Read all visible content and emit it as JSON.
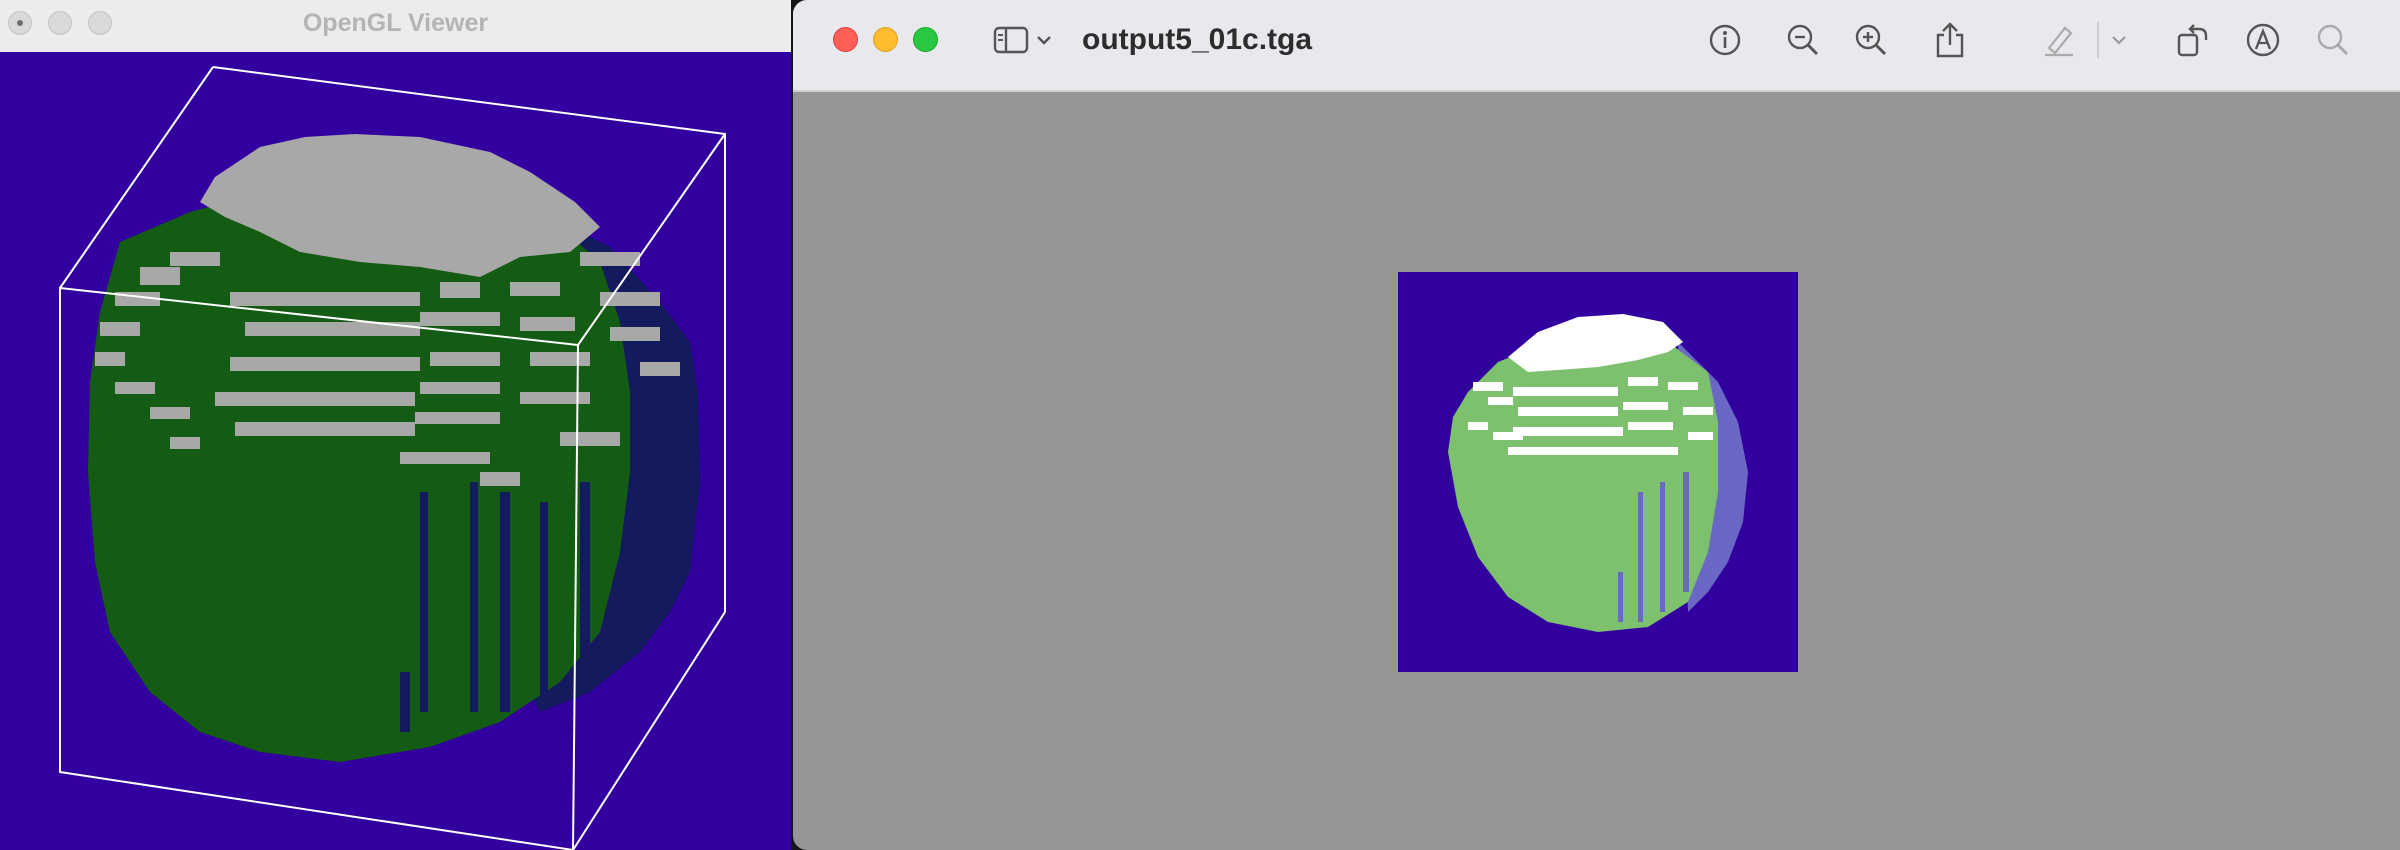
{
  "gl_window": {
    "title": "OpenGL Viewer",
    "background_color": "#3300a0",
    "sphere_colors": {
      "top": "#a8a8a8",
      "front": "#145b14",
      "side": "#141a5e"
    },
    "bounding_box_color": "#ffffff"
  },
  "preview_window": {
    "filename": "output5_01c.tga",
    "background_color": "#969696",
    "image": {
      "background_color": "#3300a0",
      "sphere_colors": {
        "top": "#ffffff",
        "front": "#7dc06e",
        "side": "#6a68c4"
      }
    },
    "toolbar": {
      "buttons": [
        {
          "icon": "sidebar-icon",
          "label": "Sidebar"
        },
        {
          "icon": "chevron-down-icon",
          "label": "Sidebar options"
        },
        {
          "icon": "info-icon",
          "label": "Info"
        },
        {
          "icon": "zoom-out-icon",
          "label": "Zoom Out"
        },
        {
          "icon": "zoom-in-icon",
          "label": "Zoom In"
        },
        {
          "icon": "share-icon",
          "label": "Share"
        },
        {
          "icon": "highlight-pen-icon",
          "label": "Highlight"
        },
        {
          "icon": "chevron-down-icon",
          "label": "Highlight options"
        },
        {
          "icon": "rotate-icon",
          "label": "Rotate"
        },
        {
          "icon": "markup-icon",
          "label": "Markup"
        },
        {
          "icon": "search-icon",
          "label": "Search"
        }
      ]
    }
  }
}
